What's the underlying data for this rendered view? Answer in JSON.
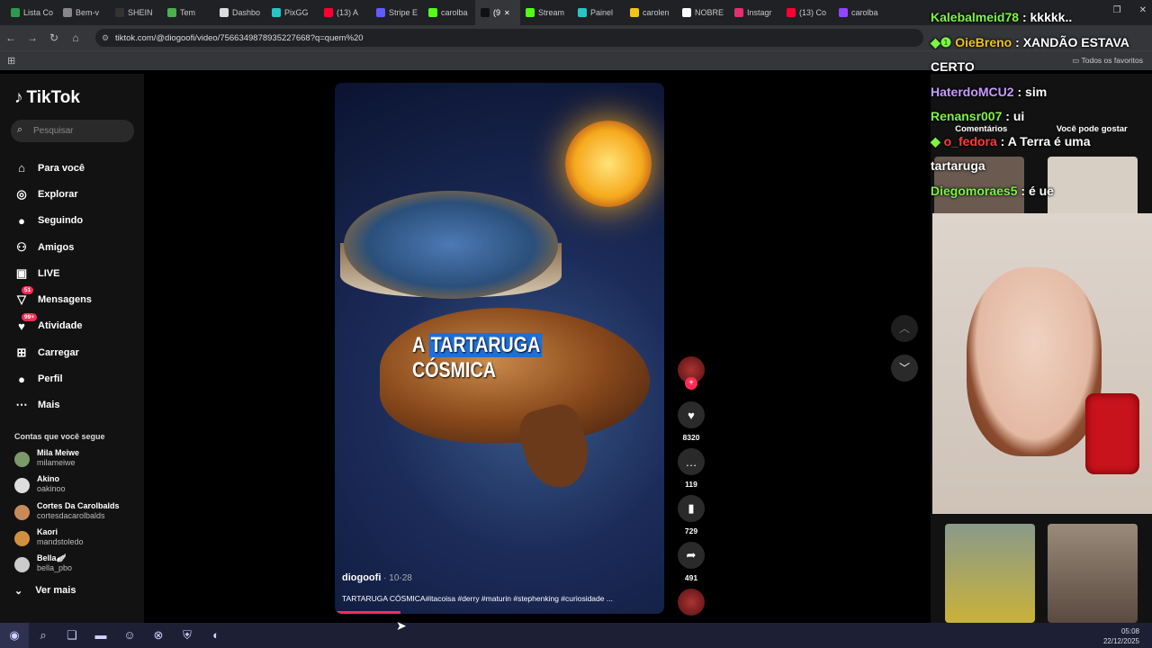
{
  "browser": {
    "tabs": [
      {
        "label": "Lista Co",
        "color": "#2e9a4f"
      },
      {
        "label": "Bem-v",
        "color": "#888"
      },
      {
        "label": "SHEIN",
        "color": "#333"
      },
      {
        "label": "Tem",
        "color": "#4caf50"
      },
      {
        "label": "Dashbo",
        "color": "#ddd"
      },
      {
        "label": "PixGG",
        "color": "#29c5c5"
      },
      {
        "label": "(13) A",
        "color": "#ff0033"
      },
      {
        "label": "Stripe E",
        "color": "#635bff"
      },
      {
        "label": "carolba",
        "color": "#53fc18"
      },
      {
        "label": "(9",
        "color": "#111",
        "active": true
      },
      {
        "label": "Stream",
        "color": "#53fc18"
      },
      {
        "label": "Painel",
        "color": "#29c5c5"
      },
      {
        "label": "carolen",
        "color": "#f0c419"
      },
      {
        "label": "NOBRE",
        "color": "#fff"
      },
      {
        "label": "Instagr",
        "color": "#e1306c"
      },
      {
        "label": "(13) Co",
        "color": "#ff0033"
      },
      {
        "label": "carolba",
        "color": "#9146ff"
      }
    ],
    "url": "tiktok.com/@diogoofi/video/7566349878935227668?q=quem%20",
    "bookmarks_all": "Todos os favoritos"
  },
  "tiktok": {
    "logo": "TikTok",
    "search_placeholder": "Pesquisar",
    "nav": [
      {
        "label": "Para você",
        "icon": "home-icon",
        "glyph": "⌂"
      },
      {
        "label": "Explorar",
        "icon": "compass-icon",
        "glyph": "◎"
      },
      {
        "label": "Seguindo",
        "icon": "following-icon",
        "glyph": "●"
      },
      {
        "label": "Amigos",
        "icon": "friends-icon",
        "glyph": "⚇"
      },
      {
        "label": "LIVE",
        "icon": "live-icon",
        "glyph": "▣"
      },
      {
        "label": "Mensagens",
        "icon": "messages-icon",
        "glyph": "▽",
        "badge": "51"
      },
      {
        "label": "Atividade",
        "icon": "activity-icon",
        "glyph": "♥",
        "badge": "99+"
      },
      {
        "label": "Carregar",
        "icon": "upload-icon",
        "glyph": "⊞"
      },
      {
        "label": "Perfil",
        "icon": "profile-icon",
        "glyph": "●"
      },
      {
        "label": "Mais",
        "icon": "more-icon",
        "glyph": "⋯"
      }
    ],
    "following_title": "Contas que você segue",
    "accounts": [
      {
        "name": "Mila Meiwe",
        "handle": "milameiwe",
        "color": "#7a9a6a"
      },
      {
        "name": "Akino",
        "handle": "oakinoo",
        "color": "#ddd"
      },
      {
        "name": "Cortes Da Carolbalds",
        "handle": "cortesdacarolbalds",
        "color": "#c98a5a"
      },
      {
        "name": "Kaori",
        "handle": "mandstoledo",
        "color": "#d09040"
      },
      {
        "name": "Bella🪽",
        "handle": "bella_pbo",
        "color": "#ccc"
      }
    ],
    "see_more": "Ver mais",
    "video": {
      "caption_pre": "A ",
      "caption_hl": "TARTARUGA",
      "caption_post": " CÓSMICA",
      "author": "diogoofi",
      "date": " · 10-28",
      "description": "TARTARUGA CÓSMICA#itacoisa #derry #maturin #stephenking #curiosidade ...",
      "progress": 0.2
    },
    "actions": {
      "likes": "8320",
      "comments": "119",
      "saves": "729",
      "shares": "491"
    },
    "panel_tabs": [
      "Comentários",
      "Você pode gostar"
    ]
  },
  "chat": [
    {
      "user": "Kalebalmeid78",
      "msg": "kkkkk..",
      "color": "#7cf542",
      "badges": ""
    },
    {
      "user": "OieBreno",
      "msg": "XANDÃO ESTAVA",
      "color": "#f0c419",
      "badges": "◆❶ "
    },
    {
      "user": "",
      "msg": "CERTO",
      "color": "#fff",
      "badges": ""
    },
    {
      "user": "HaterdoMCU2",
      "msg": "sim",
      "color": "#c79bff",
      "badges": ""
    },
    {
      "user": "Renansr007",
      "msg": "ui",
      "color": "#7cf542",
      "badges": ""
    },
    {
      "user": "o_fedora",
      "msg": "A Terra é uma",
      "color": "#ff3c3c",
      "badges": "◆ "
    },
    {
      "user": "",
      "msg": "tartaruga",
      "color": "#fff",
      "badges": ""
    },
    {
      "user": "Diegomoraes5",
      "msg": "é ue",
      "color": "#7cf542",
      "badges": ""
    }
  ],
  "taskbar": {
    "time": "05:08",
    "date": "22/12/2025"
  }
}
